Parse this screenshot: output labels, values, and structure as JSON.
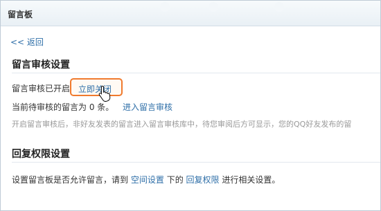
{
  "window": {
    "title": "留言板"
  },
  "nav": {
    "back_label": "<< 返回"
  },
  "moderation": {
    "heading": "留言审核设置",
    "status_text": "留言审核已开启",
    "close_now_label": "立即关闭",
    "pending_text": "当前待审核的留言为 0 条。",
    "enter_review_label": "进入留言审核",
    "hint": "开启留言审核后，非好友发表的留言进入留言审核库中，待您审阅后方可显示，您的QQ好友发布的留"
  },
  "reply": {
    "heading": "回复权限设置",
    "desc_prefix": "设置留言板是否允许留言，请到",
    "space_settings_label": "空间设置",
    "desc_mid": "下的",
    "reply_permission_label": "回复权限",
    "desc_suffix": "进行相关设置。"
  },
  "colors": {
    "link": "#2f6fa8",
    "highlight_border": "#f07a2d",
    "hint": "#999999"
  },
  "icons": {
    "cursor": "hand-pointer-icon"
  }
}
